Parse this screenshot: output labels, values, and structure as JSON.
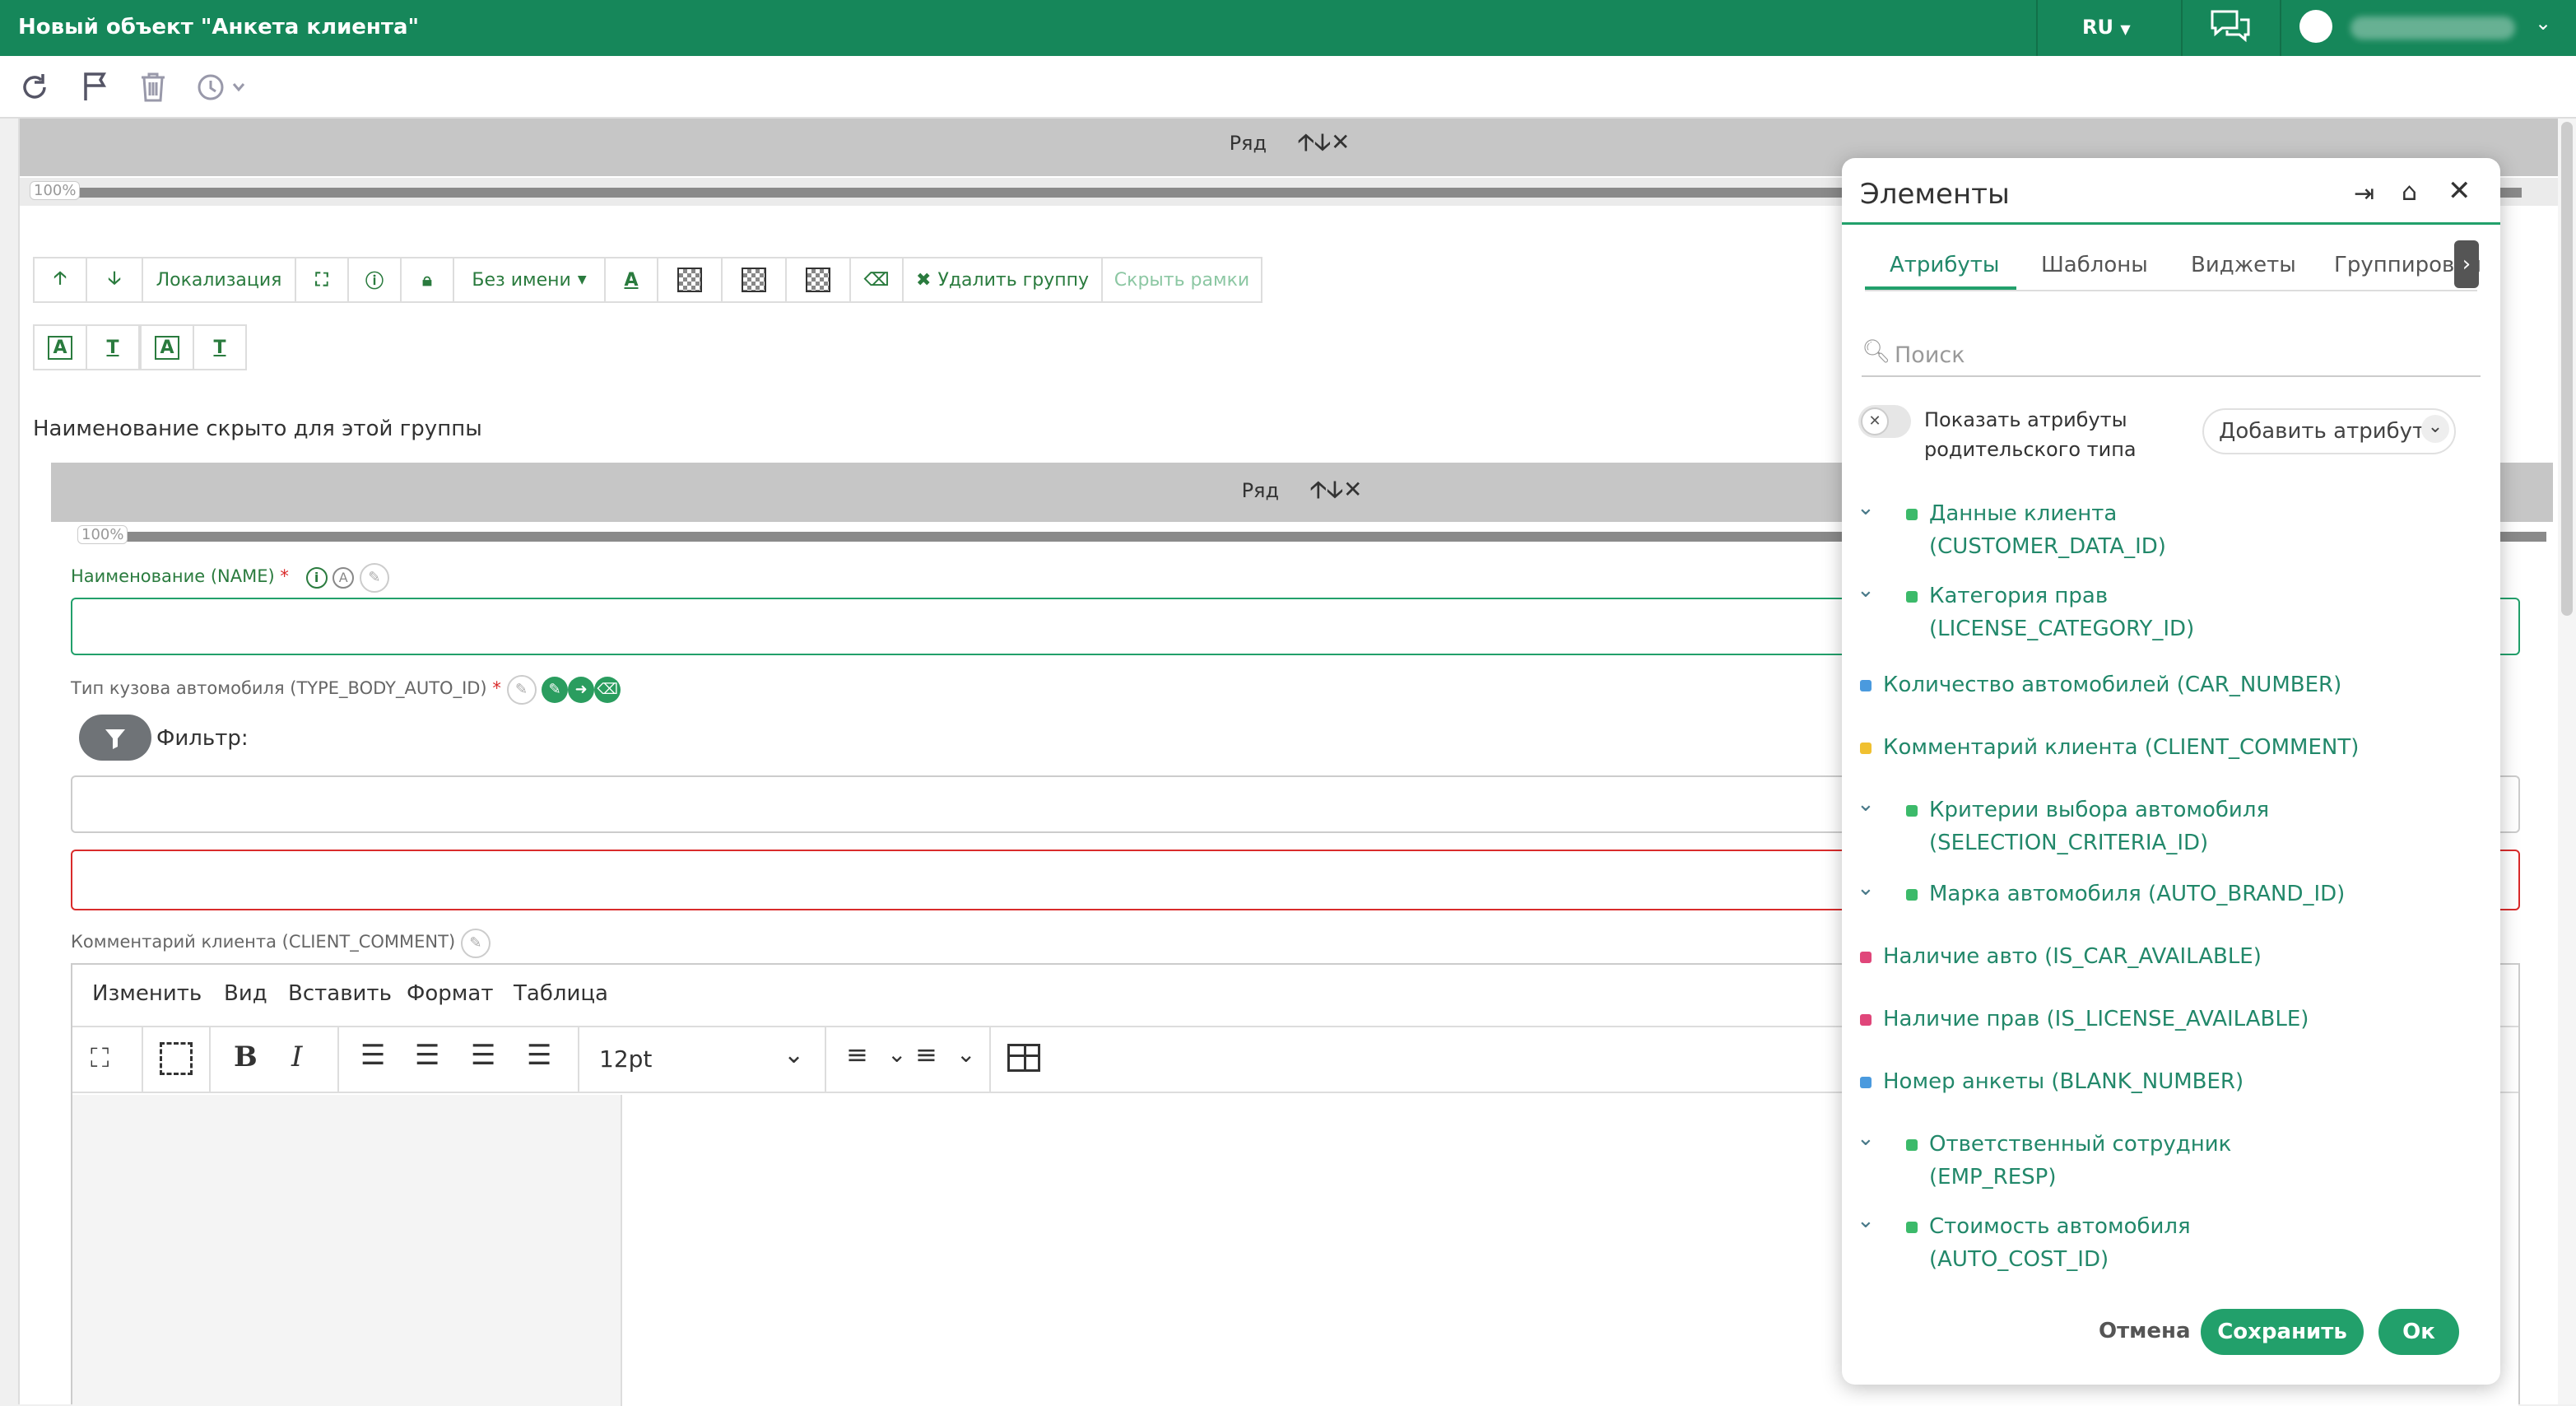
{
  "window": {
    "title": "Новый объект \"Анкета клиента\"",
    "lang": "RU"
  },
  "row_label": "Ряд",
  "progress": "100%",
  "group_toolbar": {
    "localization": "Локализация",
    "no_name": "Без имени",
    "delete_group": "Удалить группу",
    "hide_frames": "Скрыть рамки"
  },
  "hidden_name_note": "Наименование скрыто для этой группы",
  "fields": {
    "name_label": "Наименование (NAME)",
    "body_type_label": "Тип кузова автомобиля (TYPE_BODY_AUTO_ID)",
    "filter_label": "Фильтр:",
    "comment_label": "Комментарий клиента (CLIENT_COMMENT)",
    "required_mark": "*"
  },
  "editor": {
    "menu": [
      "Изменить",
      "Вид",
      "Вставить",
      "Формат",
      "Таблица"
    ],
    "font_size": "12pt"
  },
  "panel": {
    "title": "Элементы",
    "tabs": [
      "Атрибуты",
      "Шаблоны",
      "Виджеты",
      "Группировки"
    ],
    "active_tab": "Атрибуты",
    "search_placeholder": "Поиск",
    "toggle_label_1": "Показать атрибуты",
    "toggle_label_2": "родительского типа",
    "add_attribute": "Добавить атрибут",
    "attributes": [
      {
        "line1": "Данные клиента",
        "line2": "(CUSTOMER_DATA_ID)",
        "color": "#3cba6a",
        "expandable": true
      },
      {
        "line1": "Категория прав",
        "line2": "(LICENSE_CATEGORY_ID)",
        "color": "#3cba6a",
        "expandable": true
      },
      {
        "line1": "Количество автомобилей (CAR_NUMBER)",
        "line2": "",
        "color": "#4a9ade",
        "expandable": false
      },
      {
        "line1": "Комментарий клиента (CLIENT_COMMENT)",
        "line2": "",
        "color": "#f0c030",
        "expandable": false
      },
      {
        "line1": "Критерии выбора автомобиля",
        "line2": "(SELECTION_CRITERIA_ID)",
        "color": "#3cba6a",
        "expandable": true
      },
      {
        "line1": "Марка автомобиля (AUTO_BRAND_ID)",
        "line2": "",
        "color": "#3cba6a",
        "expandable": true
      },
      {
        "line1": "Наличие авто (IS_CAR_AVAILABLE)",
        "line2": "",
        "color": "#e0467a",
        "expandable": false
      },
      {
        "line1": "Наличие прав (IS_LICENSE_AVAILABLE)",
        "line2": "",
        "color": "#e0467a",
        "expandable": false
      },
      {
        "line1": "Номер анкеты (BLANK_NUMBER)",
        "line2": "",
        "color": "#4a9ade",
        "expandable": false
      },
      {
        "line1": "Ответственный сотрудник",
        "line2": "(EMP_RESP)",
        "color": "#3cba6a",
        "expandable": true
      },
      {
        "line1": "Стоимость автомобиля",
        "line2": "(AUTO_COST_ID)",
        "color": "#3cba6a",
        "expandable": true
      }
    ],
    "cancel": "Отмена",
    "save": "Сохранить",
    "ok": "Ок"
  },
  "colors": {
    "brand": "#16875a",
    "accent": "#22a06b",
    "error": "#d92b2b"
  }
}
